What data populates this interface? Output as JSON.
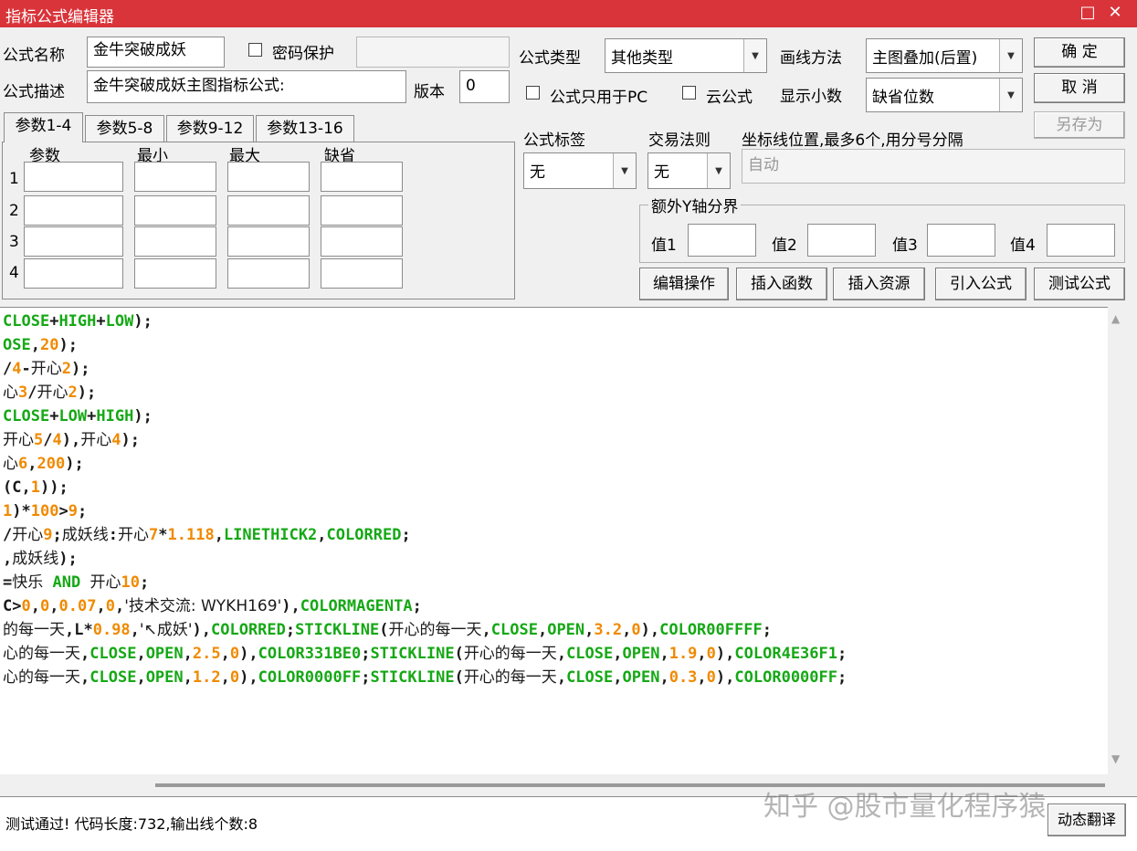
{
  "window": {
    "title": "指标公式编辑器",
    "maximize_glyph": "□",
    "close_glyph": "✕"
  },
  "form": {
    "name_label": "公式名称",
    "name_value": "金牛突破成妖",
    "password_label": "密码保护",
    "desc_label": "公式描述",
    "desc_value": "金牛突破成妖主图指标公式:",
    "version_label": "版本",
    "version_value": "0",
    "type_label": "公式类型",
    "type_value": "其他类型",
    "draw_label": "画线方法",
    "draw_value": "主图叠加(后置)",
    "pc_only_label": "公式只用于PC",
    "cloud_label": "云公式",
    "decimals_label": "显示小数",
    "decimals_value": "缺省位数",
    "tag_label": "公式标签",
    "tag_value": "无",
    "rule_label": "交易法则",
    "rule_value": "无",
    "coord_label": "坐标线位置,最多6个,用分号分隔",
    "coord_placeholder": "自动",
    "yaxis_group_label": "额外Y轴分界",
    "y1_label": "值1",
    "y2_label": "值2",
    "y3_label": "值3",
    "y4_label": "值4"
  },
  "buttons": {
    "ok": "确  定",
    "cancel": "取  消",
    "save_as": "另存为",
    "edit_ops": "编辑操作",
    "insert_func": "插入函数",
    "insert_res": "插入资源",
    "import_formula": "引入公式",
    "test_formula": "测试公式",
    "dynamic_translate": "动态翻译"
  },
  "params": {
    "tabs": [
      "参数1-4",
      "参数5-8",
      "参数9-12",
      "参数13-16"
    ],
    "headers": [
      "参数",
      "最小",
      "最大",
      "缺省"
    ],
    "rows": [
      "1",
      "2",
      "3",
      "4"
    ]
  },
  "scroll": {
    "up": "▲",
    "down": "▼",
    "arrow": "▼"
  },
  "status": {
    "message": "测试通过! 代码长度:732,输出线个数:8"
  },
  "watermark": "知乎 @股市量化程序猿",
  "code": [
    "CLOSE+HIGH+LOW);",
    "OSE,20);",
    "/4-开心2);",
    "心3/开心2);",
    "CLOSE+LOW+HIGH);",
    "开心5/4),开心4);",
    "心6,200);",
    "(C,1));",
    "1)*100>9;",
    "/开心9;成妖线:开心7*1.118,LINETHICK2,COLORRED;",
    ",成妖线);",
    "=快乐 AND 开心10;",
    "C>0,0,0.07,0,'技术交流: WYKH169'),COLORMAGENTA;",
    "的每一天,L*0.98,'↖成妖'),COLORRED;STICKLINE(开心的每一天,CLOSE,OPEN,3.2,0),COLOR00FFFF;",
    "心的每一天,CLOSE,OPEN,2.5,0),COLOR331BE0;STICKLINE(开心的每一天,CLOSE,OPEN,1.9,0),COLOR4E36F1;",
    "心的每一天,CLOSE,OPEN,1.2,0),COLOR0000FF;STICKLINE(开心的每一天,CLOSE,OPEN,0.3,0),COLOR0000FF;"
  ]
}
